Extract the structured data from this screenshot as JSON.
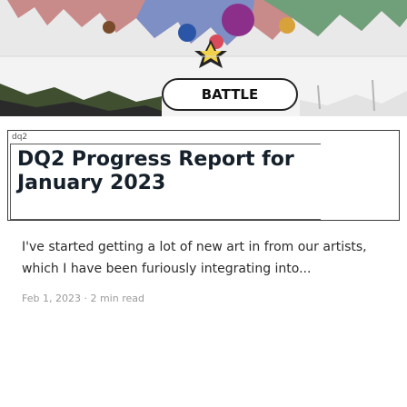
{
  "hero": {
    "battle_label": "BATTLE"
  },
  "post": {
    "thumbnail_tag": "dq2",
    "title": "DQ2 Progress Report for January 2023",
    "teaser": "I've started getting a lot of new art in from our artists, which I have been furiously integrating into...",
    "date": "Feb 1, 2023",
    "separator": "·",
    "read_time": "2 min read"
  }
}
